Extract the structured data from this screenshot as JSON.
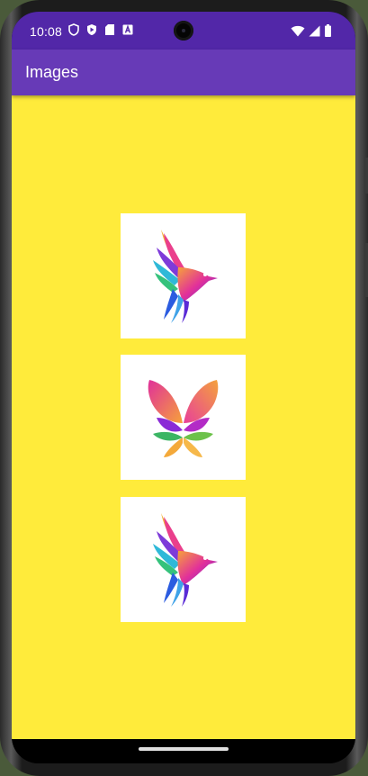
{
  "status_bar": {
    "time": "10:08",
    "left_icons": [
      "shield-icon",
      "play-protect-icon",
      "sd-card-icon",
      "a-badge-icon"
    ],
    "right_icons": [
      "wifi-icon",
      "cell-signal-icon",
      "battery-icon"
    ]
  },
  "app_bar": {
    "title": "Images",
    "color": "#673ab7",
    "status_color": "#5227a8"
  },
  "content": {
    "background": "#ffeb3b",
    "images": [
      {
        "icon": "hummingbird-logo-icon"
      },
      {
        "icon": "butterfly-lotus-logo-icon"
      },
      {
        "icon": "hummingbird-logo-icon"
      }
    ]
  },
  "nav_bar": {
    "handle": "gesture-handle"
  }
}
